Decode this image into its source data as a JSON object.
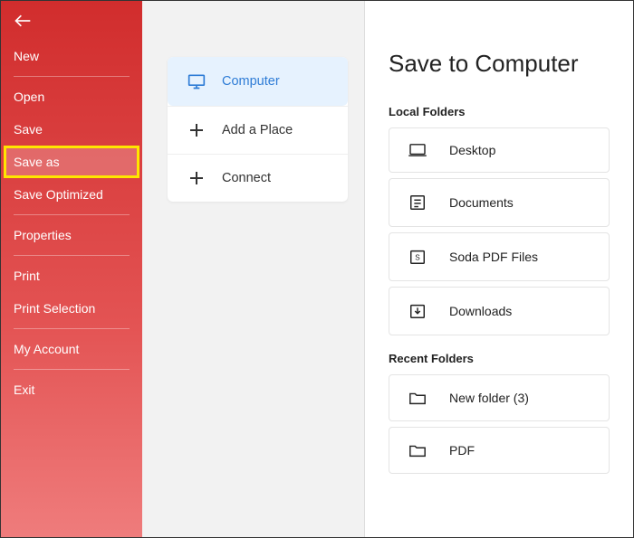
{
  "sidebar": {
    "items": [
      {
        "label": "New"
      },
      {
        "label": "Open"
      },
      {
        "label": "Save"
      },
      {
        "label": "Save as",
        "selected": true
      },
      {
        "label": "Save Optimized"
      },
      {
        "label": "Properties"
      },
      {
        "label": "Print"
      },
      {
        "label": "Print Selection"
      },
      {
        "label": "My Account"
      },
      {
        "label": "Exit"
      }
    ]
  },
  "locations": {
    "items": [
      {
        "label": "Computer",
        "icon": "monitor",
        "active": true
      },
      {
        "label": "Add a Place",
        "icon": "plus"
      },
      {
        "label": "Connect",
        "icon": "plus"
      }
    ]
  },
  "content": {
    "title": "Save to Computer",
    "local_label": "Local Folders",
    "recent_label": "Recent Folders",
    "local_folders": [
      {
        "label": "Desktop",
        "icon": "laptop"
      },
      {
        "label": "Documents",
        "icon": "documents"
      },
      {
        "label": "Soda PDF Files",
        "icon": "soda"
      },
      {
        "label": "Downloads",
        "icon": "download"
      }
    ],
    "recent_folders": [
      {
        "label": "New folder (3)",
        "icon": "folder"
      },
      {
        "label": "PDF",
        "icon": "folder"
      }
    ]
  }
}
